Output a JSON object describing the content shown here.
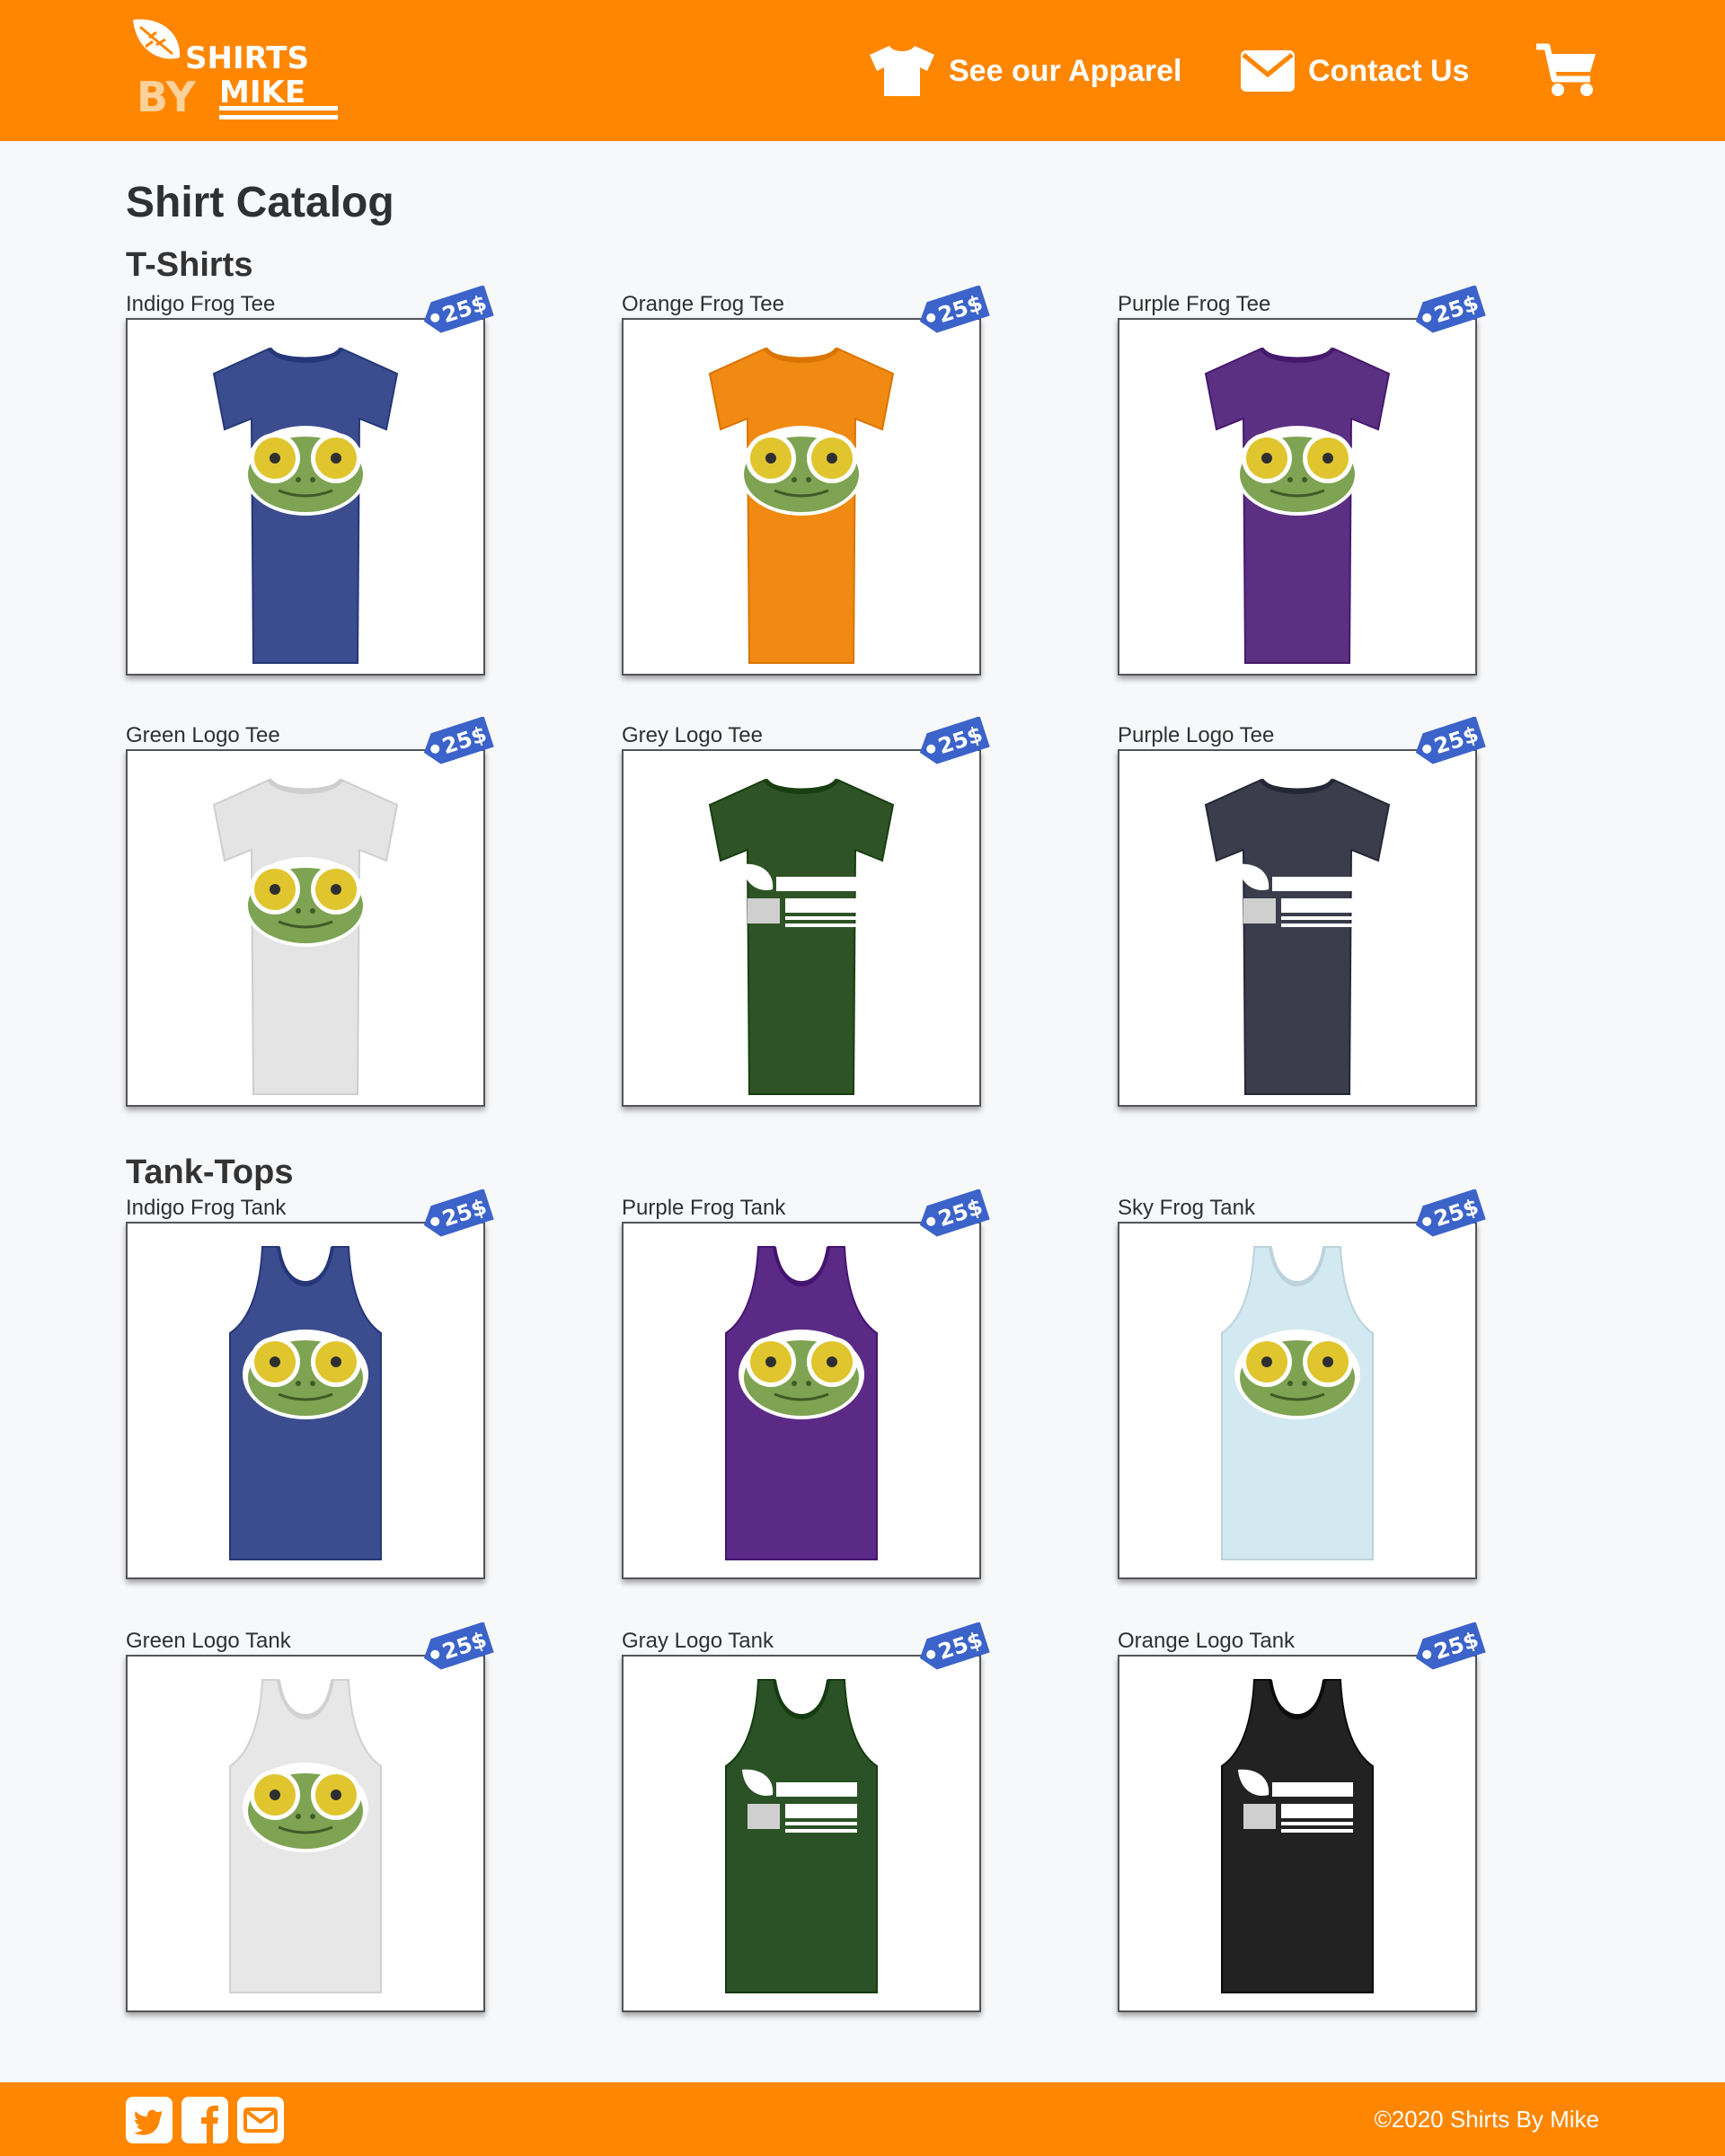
{
  "header": {
    "logo": {
      "line1": "SHIRTS",
      "by": "BY",
      "line2": "MIKE"
    },
    "nav": [
      {
        "label": "See our Apparel",
        "icon": "tshirt-icon"
      },
      {
        "label": "Contact Us",
        "icon": "envelope-icon"
      }
    ],
    "cart_icon": "shopping-cart-icon"
  },
  "main": {
    "title": "Shirt Catalog",
    "sections": [
      {
        "title": "T-Shirts",
        "items": [
          {
            "name": "Indigo Frog Tee",
            "price": "25$",
            "garment": "tee",
            "color": "#3b4d8e",
            "print": "frog"
          },
          {
            "name": "Orange Frog Tee",
            "price": "25$",
            "garment": "tee",
            "color": "#f08a12",
            "print": "frog"
          },
          {
            "name": "Purple Frog Tee",
            "price": "25$",
            "garment": "tee",
            "color": "#5b2f82",
            "print": "frog"
          },
          {
            "name": "Green Logo Tee",
            "price": "25$",
            "garment": "tee",
            "color": "#e4e4e4",
            "print": "frog"
          },
          {
            "name": "Grey Logo Tee",
            "price": "25$",
            "garment": "tee",
            "color": "#2e5426",
            "print": "logo"
          },
          {
            "name": "Purple Logo Tee",
            "price": "25$",
            "garment": "tee",
            "color": "#3b3d4c",
            "print": "logo"
          }
        ]
      },
      {
        "title": "Tank-Tops",
        "items": [
          {
            "name": "Indigo Frog Tank",
            "price": "25$",
            "garment": "tank",
            "color": "#3b4d8e",
            "print": "frog"
          },
          {
            "name": "Purple Frog Tank",
            "price": "25$",
            "garment": "tank",
            "color": "#5b2a86",
            "print": "frog"
          },
          {
            "name": "Sky Frog Tank",
            "price": "25$",
            "garment": "tank",
            "color": "#d3e9f1",
            "print": "frog"
          },
          {
            "name": "Green Logo Tank",
            "price": "25$",
            "garment": "tank",
            "color": "#e7e7e7",
            "print": "frog"
          },
          {
            "name": "Gray Logo Tank",
            "price": "25$",
            "garment": "tank",
            "color": "#2b5226",
            "print": "logo"
          },
          {
            "name": "Orange Logo Tank",
            "price": "25$",
            "garment": "tank",
            "color": "#222222",
            "print": "logo"
          }
        ]
      }
    ]
  },
  "footer": {
    "social": [
      "twitter-icon",
      "facebook-icon",
      "mail-icon"
    ],
    "copyright": "©2020 Shirts By Mike"
  },
  "colors": {
    "brand": "#ff8600",
    "tag": "#3b63c9",
    "background": "#f7f8fa"
  }
}
